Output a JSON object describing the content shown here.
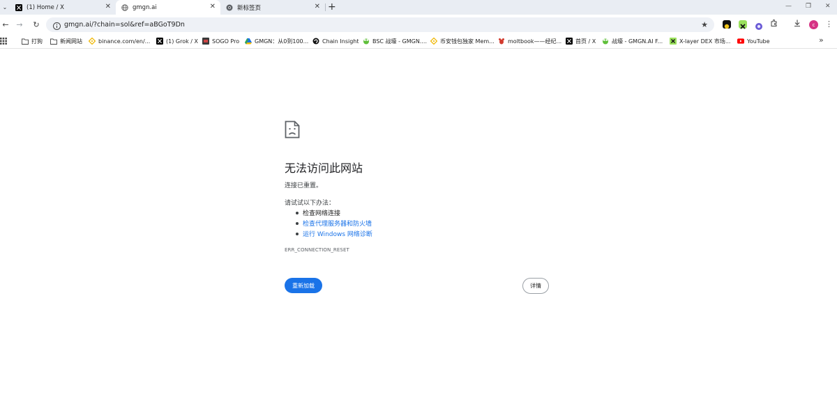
{
  "tabs": [
    {
      "title": "(1) Home / X",
      "icon": "x-logo-icon",
      "active": false
    },
    {
      "title": "gmgn.ai",
      "icon": "globe-icon",
      "active": true
    },
    {
      "title": "新标签页",
      "icon": "chrome-icon",
      "active": false
    }
  ],
  "toolbar": {
    "url": "gmgn.ai/?chain=sol&ref=aBGoT9Dn",
    "profile_initial": "c"
  },
  "bookmarks": [
    {
      "label": "打狗",
      "icon": "folder-icon"
    },
    {
      "label": "新闻网站",
      "icon": "folder-icon"
    },
    {
      "label": "binance.com/en/...",
      "icon": "binance-icon"
    },
    {
      "label": "(1) Grok / X",
      "icon": "x-logo-icon"
    },
    {
      "label": "SOGO Pro",
      "icon": "sogo-icon"
    },
    {
      "label": "GMGN：从0到100...",
      "icon": "drive-icon"
    },
    {
      "label": "Chain Insight",
      "icon": "chain-insight-icon"
    },
    {
      "label": "BSC 战壕 - GMGN....",
      "icon": "gmgn-frog-icon"
    },
    {
      "label": "币安钱包独家 Mem...",
      "icon": "binance-icon"
    },
    {
      "label": "moltbook——经纪...",
      "icon": "lobster-icon"
    },
    {
      "label": "首页 / X",
      "icon": "x-logo-icon"
    },
    {
      "label": "战壕 - GMGN.AI F...",
      "icon": "gmgn-frog-icon"
    },
    {
      "label": "X-layer DEX 市场...",
      "icon": "xlayer-icon"
    },
    {
      "label": "YouTube",
      "icon": "youtube-icon"
    }
  ],
  "error": {
    "title": "无法访问此网站",
    "subtitle": "连接已重置。",
    "try_label": "请试试以下办法：",
    "suggestions": [
      {
        "text": "检查网络连接",
        "link": false
      },
      {
        "text": "检查代理服务器和防火墙",
        "link": true
      },
      {
        "text": "运行 Windows 网络诊断",
        "link": true
      }
    ],
    "code": "ERR_CONNECTION_RESET",
    "reload_label": "重新加载",
    "details_label": "详情"
  },
  "colors": {
    "accent": "#1a73e8",
    "tabstrip": "#e9edf3",
    "omnibox": "#eef1f6"
  }
}
